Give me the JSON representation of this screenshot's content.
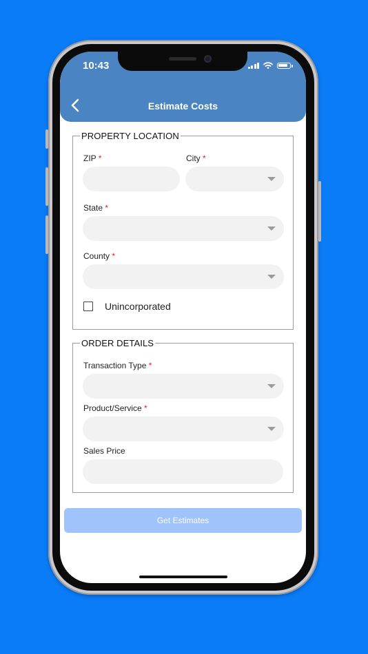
{
  "status_bar": {
    "time": "10:43"
  },
  "header": {
    "title": "Estimate Costs"
  },
  "property_location": {
    "legend": "PROPERTY LOCATION",
    "zip_label": "ZIP",
    "city_label": "City",
    "state_label": "State",
    "county_label": "County",
    "required_mark": "*",
    "unincorporated_label": "Unincorporated",
    "unincorporated_checked": false
  },
  "order_details": {
    "legend": "ORDER DETAILS",
    "transaction_type_label": "Transaction Type",
    "product_service_label": "Product/Service",
    "sales_price_label": "Sales Price",
    "required_mark": "*"
  },
  "actions": {
    "get_estimates_label": "Get Estimates"
  },
  "colors": {
    "background": "#0a7cf8",
    "header": "#4a84c2",
    "button": "#9fc3fa",
    "required": "#e02020"
  }
}
